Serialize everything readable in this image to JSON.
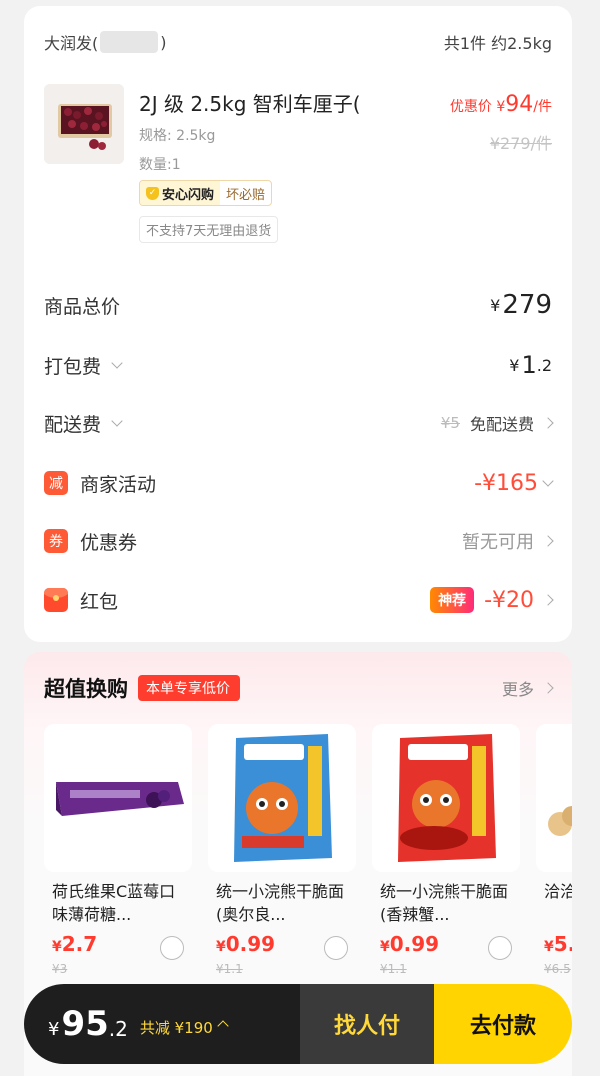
{
  "store": {
    "name": "大润发(",
    "name_suffix": ")",
    "summary": "共1件 约2.5kg"
  },
  "product": {
    "name": "2J 级 2.5kg 智利车厘子(",
    "spec": "规格: 2.5kg",
    "qty": "数量:1",
    "tag_main": "安心闪购",
    "tag_sub": "坏必赔",
    "no_return": "不支持7天无理由退货",
    "price_label": "优惠价 ¥",
    "price_value": "94",
    "price_unit": "/件",
    "orig_price": "¥279/件"
  },
  "fees": {
    "total_label": "商品总价",
    "total_yen": "¥",
    "total_value": "279",
    "packing_label": "打包费",
    "packing_yen": "¥",
    "packing_int": "1",
    "packing_dec": ".2",
    "delivery_label": "配送费",
    "delivery_strike": "¥5",
    "delivery_free": "免配送费",
    "merchant_badge": "减",
    "merchant_label": "商家活动",
    "merchant_value": "-¥165",
    "coupon_badge": "券",
    "coupon_label": "优惠券",
    "coupon_value": "暂无可用",
    "redpacket_label": "红包",
    "redpacket_tag": "神荐",
    "redpacket_value": "-¥20"
  },
  "promo": {
    "title": "超值换购",
    "tag": "本单专享低价",
    "more": "更多",
    "items": [
      {
        "name": "荷氏维果C蓝莓口味薄荷糖...",
        "yen": "¥",
        "price": "2.7",
        "orig": "¥3"
      },
      {
        "name": "统一小浣熊干脆面(奥尔良...",
        "yen": "¥",
        "price": "0.99",
        "orig": "¥1.1"
      },
      {
        "name": "统一小浣熊干脆面 (香辣蟹...",
        "yen": "¥",
        "price": "0.99",
        "orig": "¥1.1"
      },
      {
        "name": "洽洽盐焗",
        "yen": "¥",
        "price": "5.",
        "orig": "¥6.5"
      }
    ]
  },
  "paybar": {
    "yen": "¥",
    "amount": "95",
    "decimal": ".2",
    "saved": "共减 ¥190",
    "ask_friend": "找人付",
    "pay": "去付款"
  },
  "colors": {
    "accent_red": "#ff3b30",
    "pay_yellow": "#ffd400",
    "dark": "#1e1e1e"
  }
}
